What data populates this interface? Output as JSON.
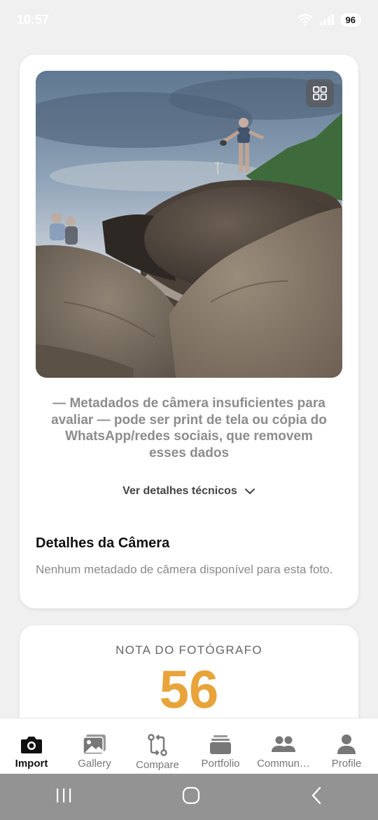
{
  "status_bar": {
    "time": "10:57",
    "battery": "96"
  },
  "photo_card": {
    "expand_icon": "grid-icon",
    "warning": "— Metadados de câmera insuficientes para avaliar — pode ser print de tela ou cópia do WhatsApp/redes sociais, que removem esses dados",
    "tech_details_label": "Ver detalhes técnicos",
    "camera_title": "Detalhes da Câmera",
    "camera_desc": "Nenhum metadado de câmera disponível para esta foto."
  },
  "score_card": {
    "label": "NOTA DO FOTÓGRAFO",
    "value": "56",
    "value_color": "#e8a33a"
  },
  "bottom_nav": {
    "items": [
      {
        "label": "Import",
        "icon": "camera-icon",
        "active": true
      },
      {
        "label": "Gallery",
        "icon": "image-icon",
        "active": false
      },
      {
        "label": "Compare",
        "icon": "compare-icon",
        "active": false
      },
      {
        "label": "Portfolio",
        "icon": "portfolio-icon",
        "active": false
      },
      {
        "label": "Commun…",
        "icon": "people-icon",
        "active": false
      },
      {
        "label": "Profile",
        "icon": "person-icon",
        "active": false
      }
    ]
  }
}
